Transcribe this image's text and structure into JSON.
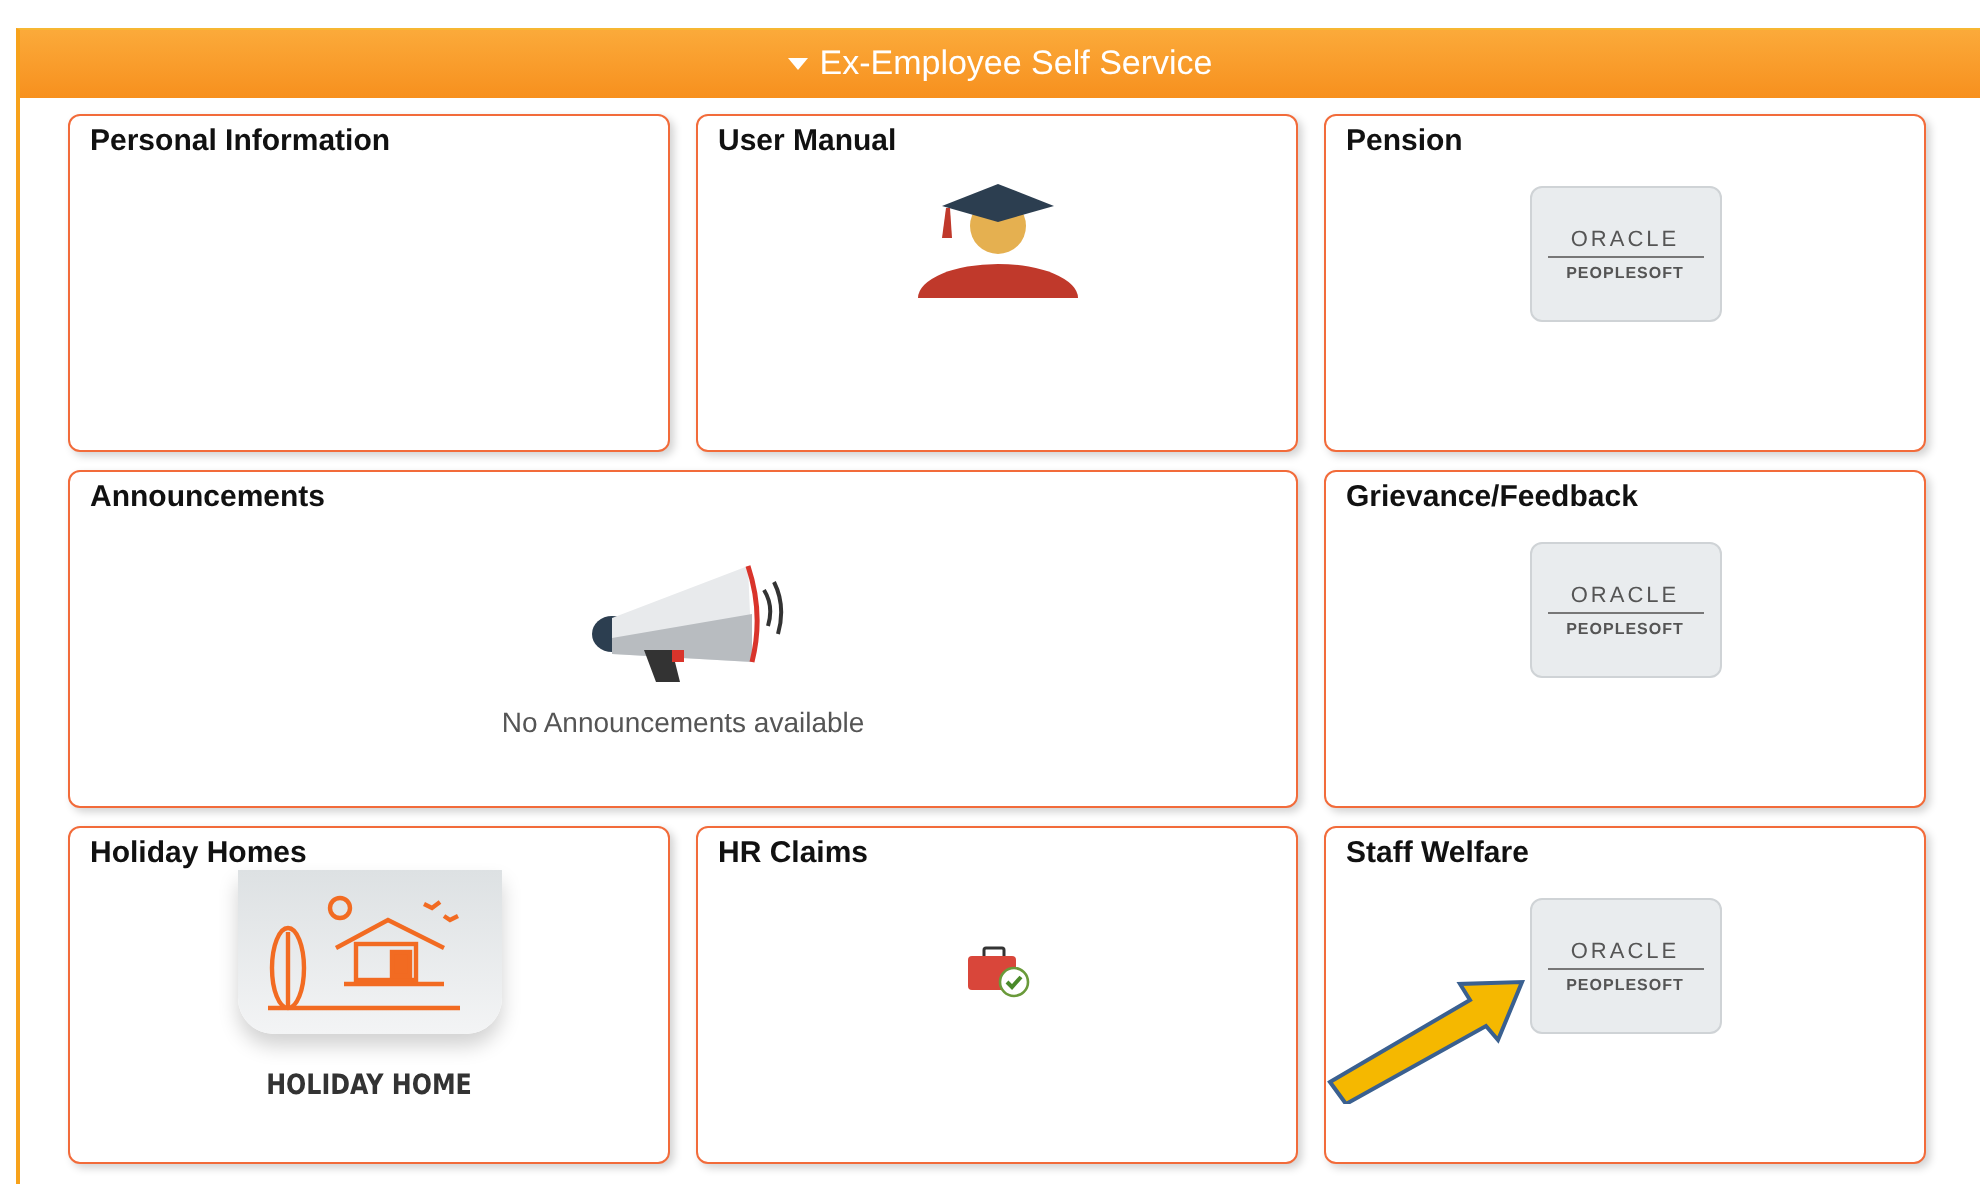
{
  "header": {
    "title": "Ex-Employee Self Service",
    "expanded": true
  },
  "tiles": [
    {
      "title": "Personal Information",
      "kind": "blank",
      "arrow": false
    },
    {
      "title": "User Manual",
      "kind": "graduate",
      "arrow": false
    },
    {
      "title": "Pension",
      "kind": "oracle",
      "logo_top": "ORACLE",
      "logo_bottom": "PEOPLESOFT",
      "arrow": false
    },
    {
      "title": "Announcements",
      "kind": "announcement",
      "message": "No Announcements available",
      "arrow": false
    },
    {
      "title": "Grievance/Feedback",
      "kind": "oracle",
      "logo_top": "ORACLE",
      "logo_bottom": "PEOPLESOFT",
      "arrow": false
    },
    {
      "title": "Holiday Homes",
      "kind": "holiday",
      "caption": "HOLIDAY HOME",
      "arrow": false
    },
    {
      "title": "HR Claims",
      "kind": "claims",
      "arrow": false
    },
    {
      "title": "Staff Welfare",
      "kind": "oracle",
      "logo_top": "ORACLE",
      "logo_bottom": "PEOPLESOFT",
      "arrow": true
    }
  ]
}
